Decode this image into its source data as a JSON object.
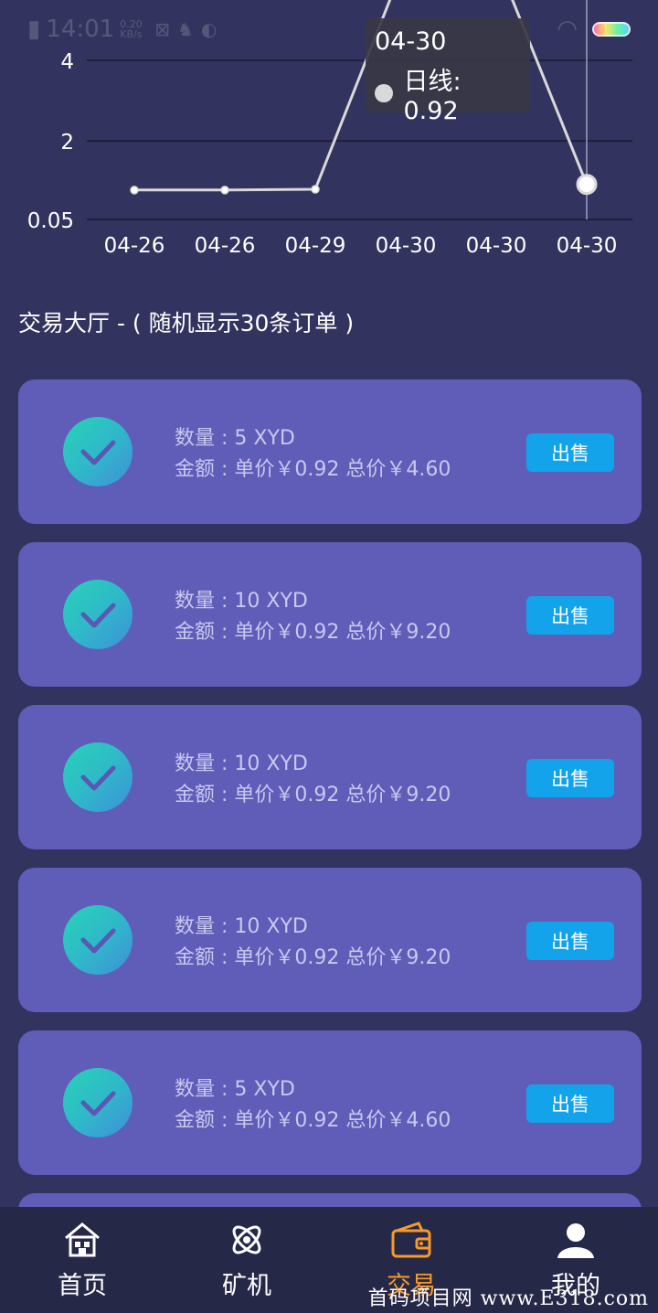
{
  "status_bar": {
    "time": "14:01",
    "speed": "0.20\nKB/s"
  },
  "chart_data": {
    "type": "line",
    "categories": [
      "04-26",
      "04-26",
      "04-29",
      "04-30",
      "04-30",
      "04-30"
    ],
    "series": [
      {
        "name": "日线",
        "values": [
          0.78,
          0.78,
          0.8,
          6.5,
          6.5,
          0.92
        ]
      }
    ],
    "y_ticks": [
      "0.05",
      "2",
      "4"
    ],
    "ylim": [
      0.05,
      4.5
    ],
    "grid": true,
    "tooltip": {
      "title": "04-30",
      "label": "日线: 0.92"
    }
  },
  "section_title": "交易大厅 - ( 随机显示30条订单 )",
  "orders": [
    {
      "quantity": "数量 : 5 XYD",
      "amount": "金额 : 单价￥0.92 总价￥4.60",
      "button": "出售"
    },
    {
      "quantity": "数量 : 10 XYD",
      "amount": "金额 : 单价￥0.92 总价￥9.20",
      "button": "出售"
    },
    {
      "quantity": "数量 : 10 XYD",
      "amount": "金额 : 单价￥0.92 总价￥9.20",
      "button": "出售"
    },
    {
      "quantity": "数量 : 10 XYD",
      "amount": "金额 : 单价￥0.92 总价￥9.20",
      "button": "出售"
    },
    {
      "quantity": "数量 : 5 XYD",
      "amount": "金额 : 单价￥0.92 总价￥4.60",
      "button": "出售"
    }
  ],
  "nav": [
    {
      "label": "首页",
      "icon": "home-icon",
      "active": false
    },
    {
      "label": "矿机",
      "icon": "miner-icon",
      "active": false
    },
    {
      "label": "交易",
      "icon": "wallet-icon",
      "active": true
    },
    {
      "label": "我的",
      "icon": "user-icon",
      "active": false
    }
  ],
  "watermark": "首码项目网  www.E318.com",
  "colors": {
    "accent": "#f59a2b",
    "card": "#5f5db8",
    "button": "#12a3ea",
    "background": "#33335f"
  }
}
